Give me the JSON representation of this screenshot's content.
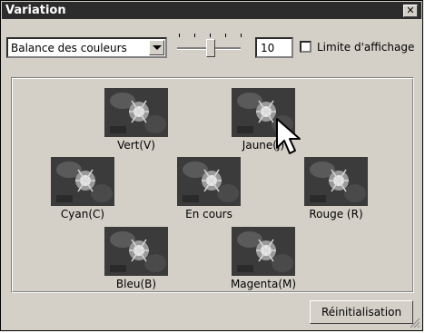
{
  "window": {
    "title": "Variation"
  },
  "toolbar": {
    "mode_select": "Balance des couleurs",
    "step_value": "10",
    "limit_checkbox_label": "Limite d'affichage",
    "limit_checked": false
  },
  "variations": [
    {
      "label": "Vert(V)"
    },
    {
      "label": "Jaune(J)"
    },
    {
      "label": "Cyan(C)"
    },
    {
      "label": "En cours"
    },
    {
      "label": "Rouge (R)"
    },
    {
      "label": "Bleu(B)"
    },
    {
      "label": "Magenta(M)"
    }
  ],
  "footer": {
    "reset_label": "Réinitialisation"
  },
  "colors": {
    "titlebar": "#2c2c2c",
    "face": "#d4d0c8"
  }
}
